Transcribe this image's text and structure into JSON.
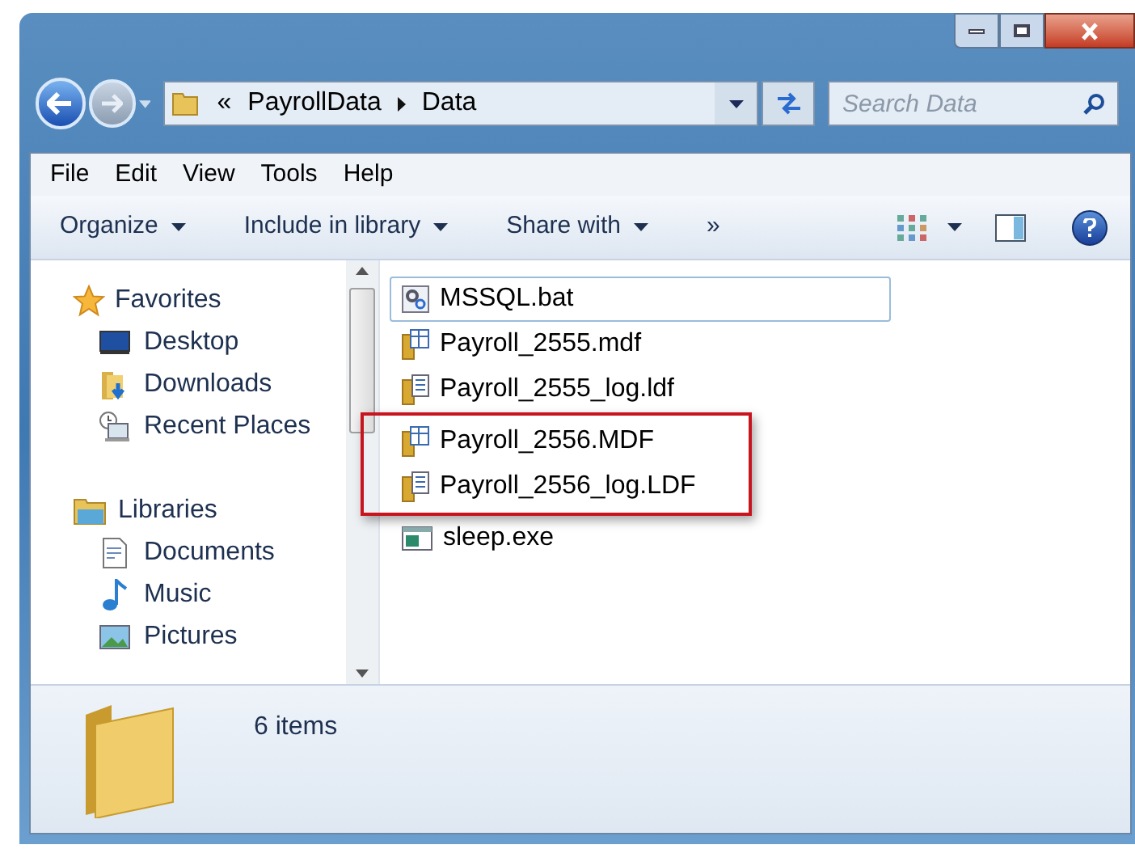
{
  "address_bar": {
    "overflow": "«",
    "crumbs": [
      "PayrollData",
      "Data"
    ]
  },
  "search": {
    "placeholder": "Search Data"
  },
  "menu": [
    "File",
    "Edit",
    "View",
    "Tools",
    "Help"
  ],
  "toolbar": {
    "buttons": [
      {
        "label": "Organize",
        "dropdown": true
      },
      {
        "label": "Include in library",
        "dropdown": true
      },
      {
        "label": "Share with",
        "dropdown": true
      }
    ],
    "more": "»"
  },
  "navigation": [
    {
      "label": "Favorites",
      "kind": "favorites",
      "children": [
        {
          "label": "Desktop",
          "kind": "desktop"
        },
        {
          "label": "Downloads",
          "kind": "downloads"
        },
        {
          "label": "Recent Places",
          "kind": "recent"
        }
      ]
    },
    {
      "label": "Libraries",
      "kind": "libraries",
      "children": [
        {
          "label": "Documents",
          "kind": "documents"
        },
        {
          "label": "Music",
          "kind": "music"
        },
        {
          "label": "Pictures",
          "kind": "pictures"
        }
      ]
    }
  ],
  "files": [
    {
      "name": "MSSQL.bat",
      "kind": "bat",
      "selected": true,
      "highlighted": false
    },
    {
      "name": "Payroll_2555.mdf",
      "kind": "mdf",
      "selected": false,
      "highlighted": false
    },
    {
      "name": "Payroll_2555_log.ldf",
      "kind": "ldf",
      "selected": false,
      "highlighted": false
    },
    {
      "name": "Payroll_2556.MDF",
      "kind": "mdf",
      "selected": false,
      "highlighted": true
    },
    {
      "name": "Payroll_2556_log.LDF",
      "kind": "ldf",
      "selected": false,
      "highlighted": true
    },
    {
      "name": "sleep.exe",
      "kind": "exe",
      "selected": false,
      "highlighted": false
    }
  ],
  "details": {
    "count": "6 items"
  }
}
